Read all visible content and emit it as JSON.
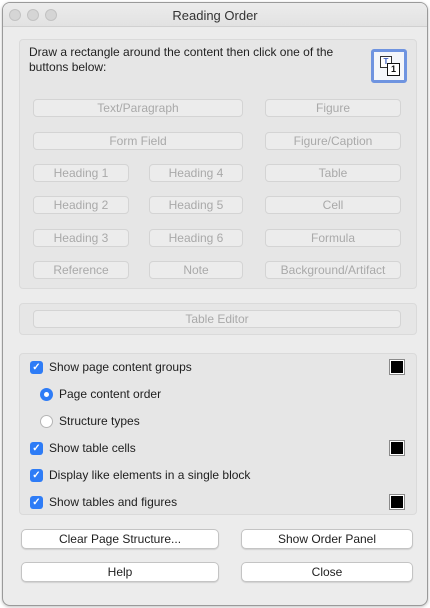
{
  "window": {
    "title": "Reading Order"
  },
  "instructions": "Draw a rectangle around the content then click one of the buttons below:",
  "tag_buttons": {
    "text_paragraph": "Text/Paragraph",
    "figure": "Figure",
    "form_field": "Form Field",
    "figure_caption": "Figure/Caption",
    "heading1": "Heading 1",
    "heading4": "Heading 4",
    "table": "Table",
    "heading2": "Heading 2",
    "heading5": "Heading 5",
    "cell": "Cell",
    "heading3": "Heading 3",
    "heading6": "Heading 6",
    "formula": "Formula",
    "reference": "Reference",
    "note": "Note",
    "background_artifact": "Background/Artifact"
  },
  "table_editor": "Table Editor",
  "options": {
    "show_page_content_groups": {
      "label": "Show page content groups",
      "checked": true,
      "color": "#000000"
    },
    "page_content_order": {
      "label": "Page content order",
      "selected": true
    },
    "structure_types": {
      "label": "Structure types",
      "selected": false
    },
    "show_table_cells": {
      "label": "Show table cells",
      "checked": true,
      "color": "#000000"
    },
    "display_like_elements": {
      "label": "Display like elements in a single block",
      "checked": true
    },
    "show_tables_figures": {
      "label": "Show tables and figures",
      "checked": true,
      "color": "#000000"
    }
  },
  "actions": {
    "clear_page_structure": "Clear Page Structure...",
    "show_order_panel": "Show Order Panel",
    "help": "Help",
    "close": "Close"
  },
  "colors": {
    "accent": "#2e7cf6",
    "icon_border": "#6f94e0"
  }
}
